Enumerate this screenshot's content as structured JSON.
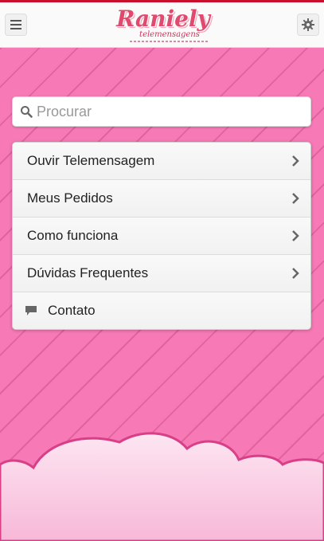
{
  "header": {
    "logo_name": "Raniely",
    "logo_sub": "telemensagens",
    "menu_icon": "hamburger-icon",
    "settings_icon": "gear-icon"
  },
  "search": {
    "placeholder": "Procurar",
    "icon": "search-icon"
  },
  "menu": {
    "items": [
      {
        "label": "Ouvir Telemensagem",
        "icon": "chevron-right-icon"
      },
      {
        "label": "Meus Pedidos",
        "icon": "chevron-right-icon"
      },
      {
        "label": "Como funciona",
        "icon": "chevron-right-icon"
      },
      {
        "label": "Dúvidas Frequentes",
        "icon": "chevron-right-icon"
      },
      {
        "label": "Contato",
        "icon": "chat-bubble-icon"
      }
    ]
  },
  "colors": {
    "accent": "#c8102e",
    "background_pink": "#f77ab7",
    "stripe": "#e1639e",
    "cloud": "#fbd6ea"
  }
}
